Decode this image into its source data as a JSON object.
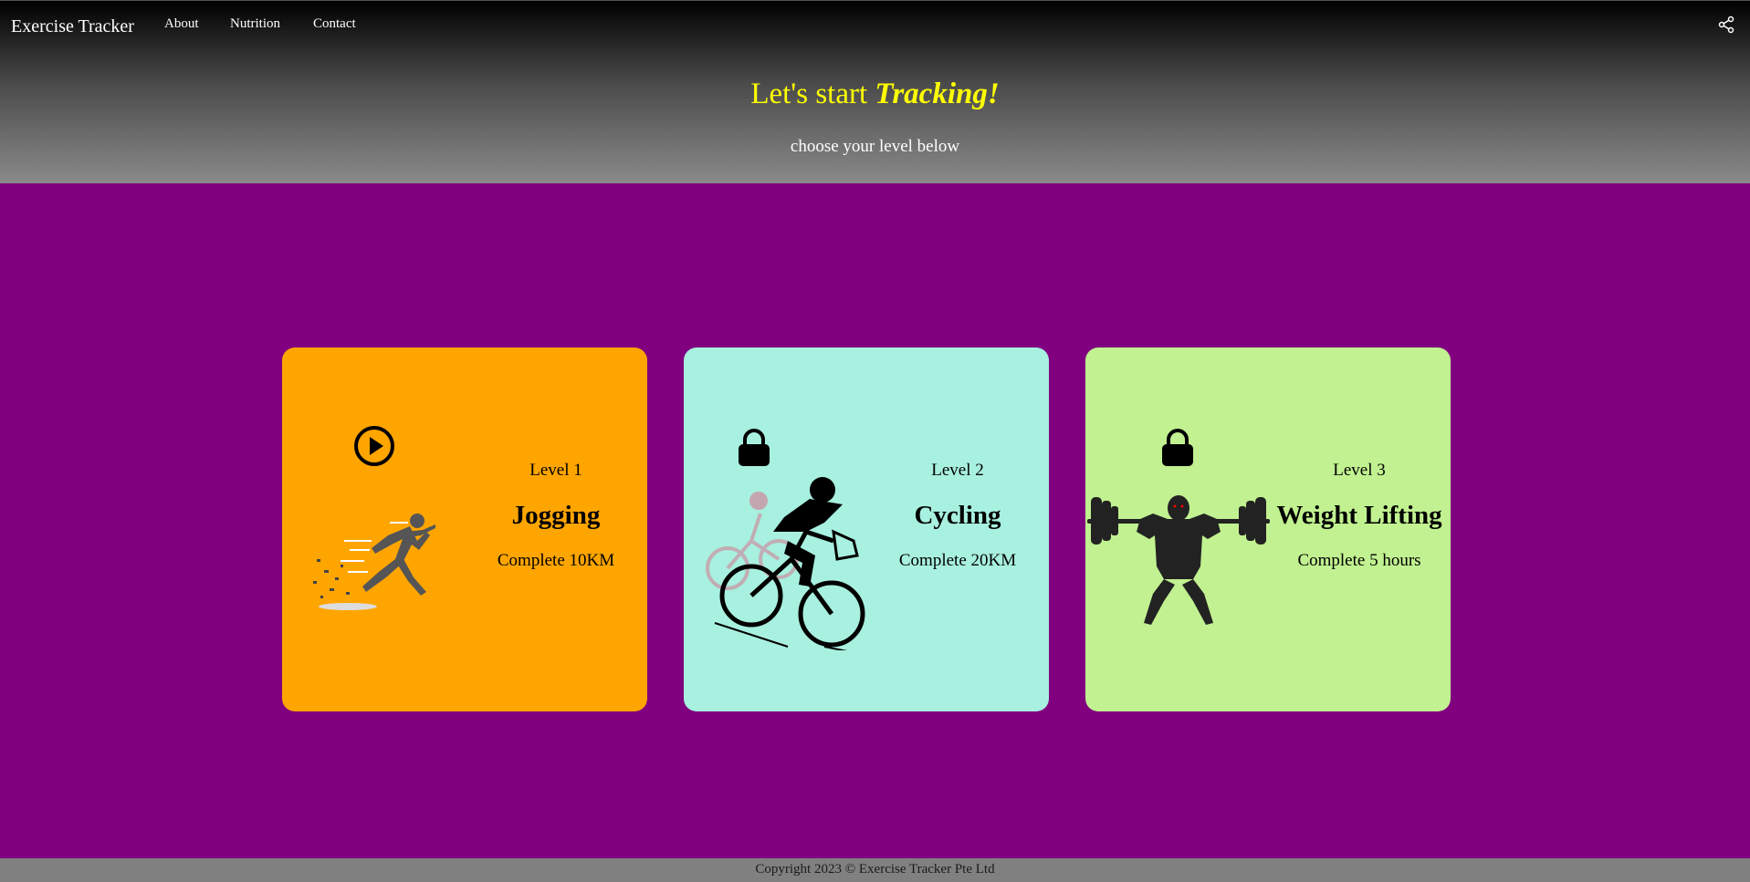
{
  "nav": {
    "brand": "Exercise Tracker",
    "links": [
      "About",
      "Nutrition",
      "Contact"
    ],
    "share_icon": "share-icon"
  },
  "hero": {
    "title_prefix": "Let's start ",
    "title_emphasis": "Tracking!",
    "subtitle": "choose your level below"
  },
  "cards": [
    {
      "level": "Level 1",
      "name": "Jogging",
      "goal": "Complete 10KM",
      "status_icon": "play-icon",
      "color": "#ffa500"
    },
    {
      "level": "Level 2",
      "name": "Cycling",
      "goal": "Complete 20KM",
      "status_icon": "lock-icon",
      "color": "#a8f0df"
    },
    {
      "level": "Level 3",
      "name": "Weight Lifting",
      "goal": "Complete 5 hours",
      "status_icon": "lock-icon",
      "color": "#c1f190"
    }
  ],
  "footer": {
    "copyright": "Copyright 2023 © Exercise Tracker Pte Ltd"
  },
  "colors": {
    "page_background": "#800080",
    "hero_title": "#ffff00"
  }
}
